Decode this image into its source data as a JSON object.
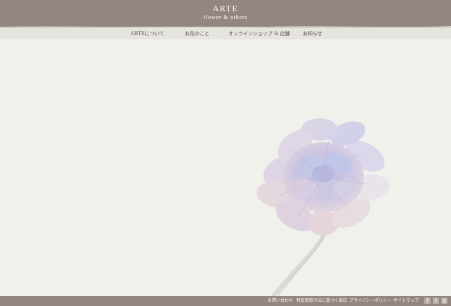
{
  "header": {
    "title": "ARTE",
    "subtitle": "flower & others"
  },
  "nav": {
    "items": [
      {
        "label": "ARTEについて"
      },
      {
        "label": "お花のこと"
      },
      {
        "label": "オンラインショップ & 店舗"
      },
      {
        "label": "お知らせ"
      }
    ]
  },
  "hero": {
    "image": "flower-illustration"
  },
  "footer": {
    "links": [
      {
        "label": "お問い合わせ"
      },
      {
        "label": "特定商取引法に基づく表記"
      },
      {
        "label": "プライバシーポリシー"
      },
      {
        "label": "サイトマップ"
      }
    ],
    "social": [
      {
        "icon": "facebook-icon",
        "glyph": "f"
      },
      {
        "icon": "twitter-icon",
        "glyph": "t"
      },
      {
        "icon": "google-plus-icon",
        "glyph": "g"
      }
    ]
  },
  "colors": {
    "header_bg": "#93857f",
    "page_bg": "#f1f1ec",
    "nav_bg": "#e6e4de",
    "nav_text": "#5b514d"
  }
}
